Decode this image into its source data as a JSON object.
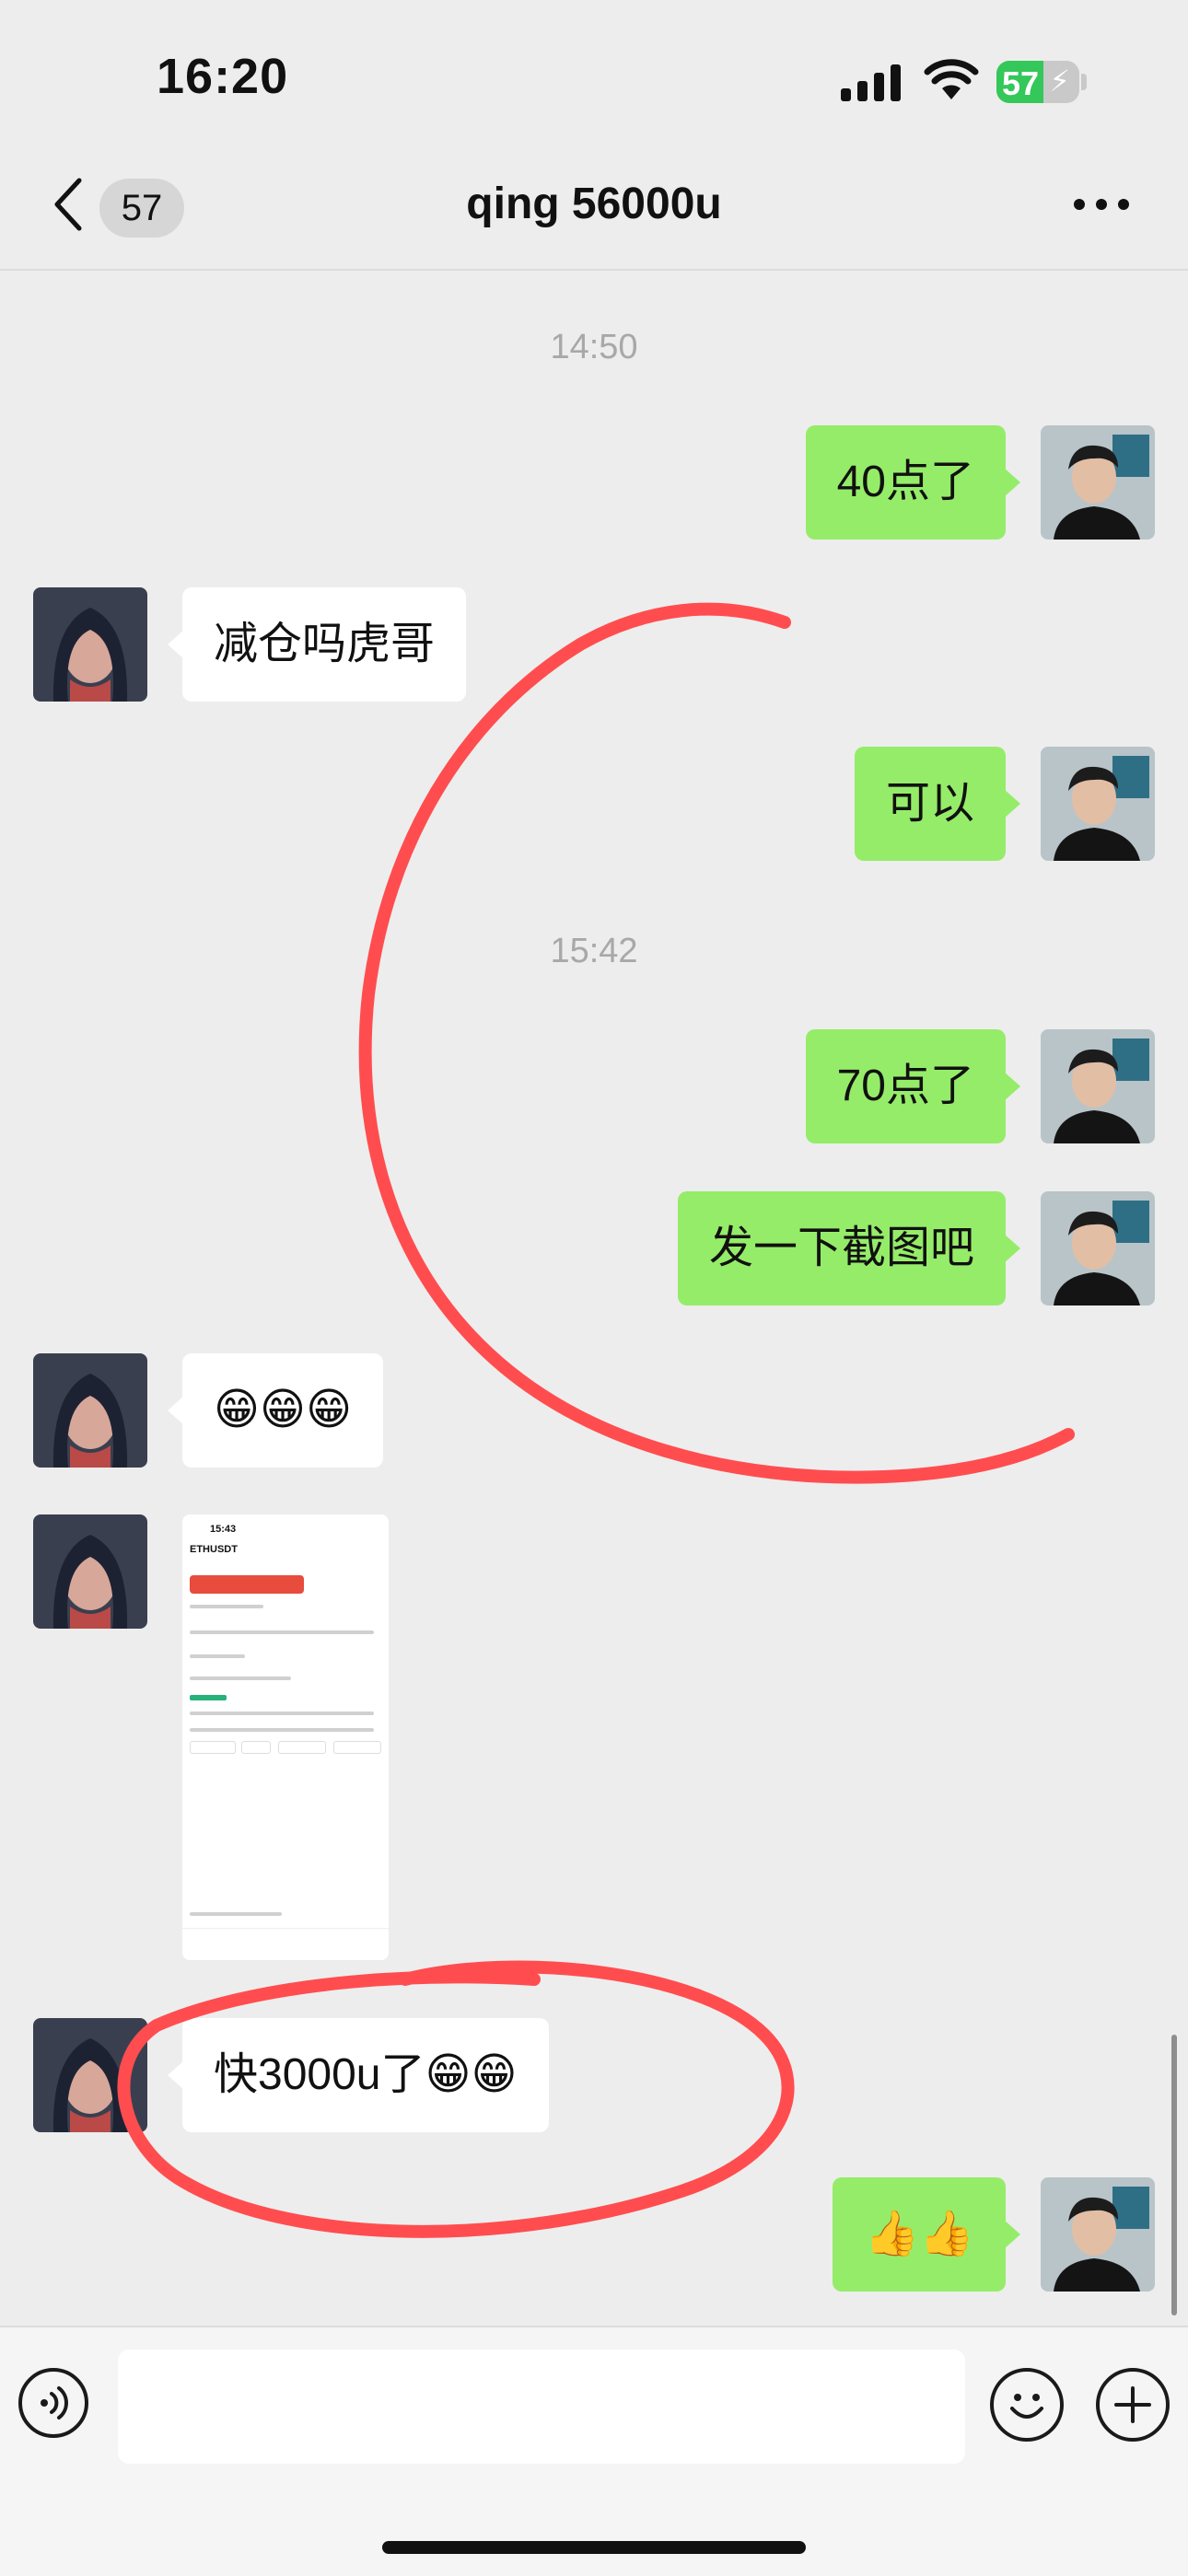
{
  "status_bar": {
    "time": "16:20",
    "battery": "57"
  },
  "header": {
    "back_count": "57",
    "title": "qing 56000u"
  },
  "colors": {
    "my_bubble": "#95ec69",
    "their_bubble": "#ffffff",
    "annotation": "#ff4d4f",
    "background": "#ededed"
  },
  "icons": {
    "back": "chevron-left-icon",
    "more": "more-dots-icon",
    "voice": "voice-icon",
    "emoji": "smiley-icon",
    "plus": "plus-icon"
  },
  "chat": {
    "timestamps": [
      "14:50",
      "15:42"
    ],
    "messages": [
      {
        "from": "me",
        "text": "40点了"
      },
      {
        "from": "them",
        "text": "减仓吗虎哥"
      },
      {
        "from": "me",
        "text": "可以"
      },
      {
        "from": "me",
        "text": "70点了"
      },
      {
        "from": "me",
        "text": "发一下截图吧"
      },
      {
        "from": "them",
        "text": "😁😁😁"
      },
      {
        "from": "them",
        "type": "image"
      },
      {
        "from": "them",
        "text": "快3000u了😁😁"
      },
      {
        "from": "me",
        "text": "👍👍"
      }
    ]
  },
  "screenshot": {
    "time": "15:43",
    "symbol": "ETHUSDT"
  }
}
